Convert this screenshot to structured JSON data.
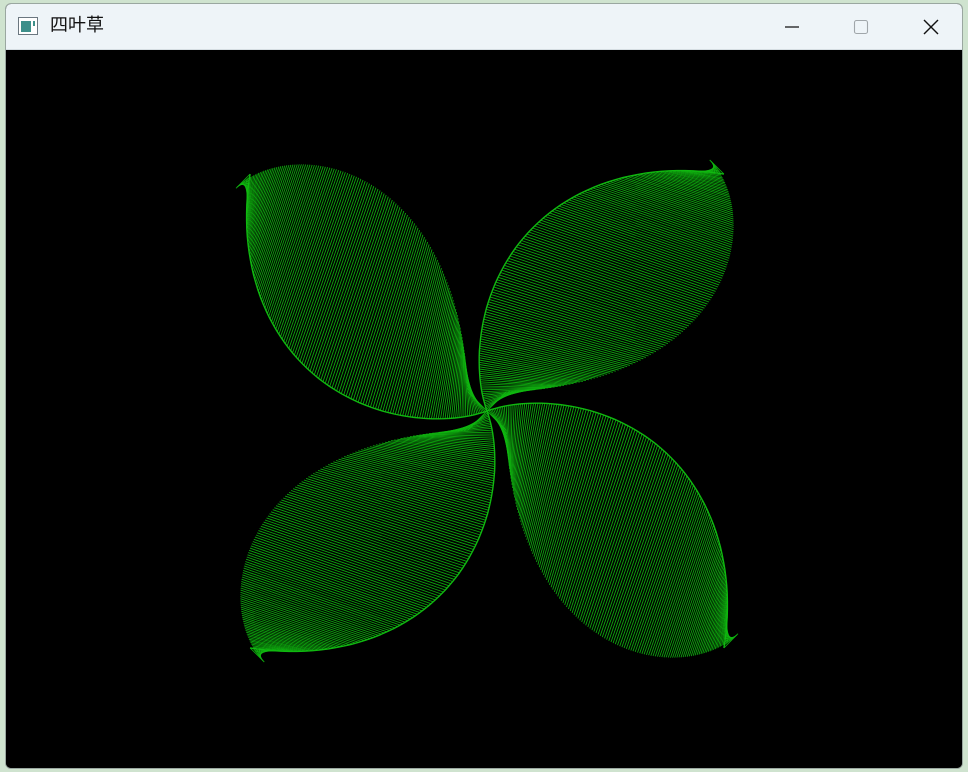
{
  "window": {
    "title": "四叶草",
    "background": "#000000",
    "titlebar_color": "#eef4f8"
  },
  "drawing": {
    "stroke_color": "#10b810",
    "leaf_count": 4
  },
  "icons": {
    "app": "app-window-icon",
    "minimize": "minimize-icon",
    "maximize": "maximize-icon",
    "close": "close-icon"
  }
}
